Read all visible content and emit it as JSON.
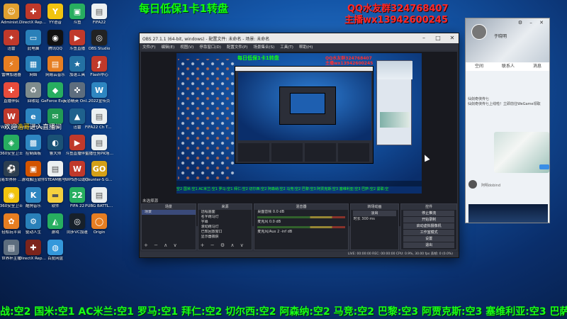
{
  "overlay": {
    "top_title": "每日低保1卡1转盘",
    "qq_group": "QQ水友群324768407",
    "host_wx": "主播wx13942600245",
    "welcome_prefix": "欢迎",
    "welcome_name": "浩哥",
    "welcome_suffix": "进入直播间",
    "ticker": "战:空2 国米:空1 AC米兰:空1 罗马:空1 拜仁:空2 切尔西:空2 阿森纳:空2 马竞:空2 巴黎:空3 阿贾克斯:空3 塞维利亚:空3 巴萨:空2 曼联:空2"
  },
  "desktop_icons": [
    {
      "label": "Administ...",
      "icon": "user-folder-icon",
      "color": "#e0a030",
      "glyph": "☺"
    },
    {
      "label": "DirectX Repair v4...",
      "icon": "directx-icon",
      "color": "#c0392b",
      "glyph": "✚"
    },
    {
      "label": "YY语音",
      "icon": "yy-icon",
      "color": "#f1c40f",
      "glyph": "Y"
    },
    {
      "label": "斗鱼",
      "icon": "app-icon",
      "color": "#27ae60",
      "glyph": "▣"
    },
    {
      "label": "FIFA22",
      "icon": "file-icon",
      "color": "#ecf0f1",
      "glyph": "▤"
    },
    {
      "label": "迅雷",
      "icon": "app-icon",
      "color": "#c0392b",
      "glyph": "✦"
    },
    {
      "label": "此电脑",
      "icon": "computer-icon",
      "color": "#2980b9",
      "glyph": "▭"
    },
    {
      "label": "腾讯QQ",
      "icon": "qq-icon",
      "color": "#111111",
      "glyph": "◉"
    },
    {
      "label": "斗鱼直播",
      "icon": "app-icon",
      "color": "#c0392b",
      "glyph": "▶"
    },
    {
      "label": "OBS Studio",
      "icon": "obs-icon",
      "color": "#222222",
      "glyph": "◎"
    },
    {
      "label": "雷神加速器",
      "icon": "app-icon",
      "color": "#e67e22",
      "glyph": "⚡"
    },
    {
      "label": "网络",
      "icon": "network-icon",
      "color": "#2980b9",
      "glyph": "▦"
    },
    {
      "label": "网易云音乐",
      "icon": "file-icon",
      "color": "#e67e22",
      "glyph": "▤"
    },
    {
      "label": "加速工具",
      "icon": "app-icon",
      "color": "#2471a3",
      "glyph": "★"
    },
    {
      "label": "Flash中心",
      "icon": "flash-icon",
      "color": "#c0392b",
      "glyph": "ƒ"
    },
    {
      "label": "直播伴侣",
      "icon": "app-icon",
      "color": "#e74c3c",
      "glyph": "✚"
    },
    {
      "label": "回收站",
      "icon": "recycle-bin-icon",
      "color": "#7f8c8d",
      "glyph": "♻"
    },
    {
      "label": "GeForce Experience",
      "icon": "nvidia-icon",
      "color": "#27ae60",
      "glyph": "◆"
    },
    {
      "label": "反恐精英 Online",
      "icon": "game-icon",
      "color": "#5d6d7e",
      "glyph": "✜"
    },
    {
      "label": "2022宣传页",
      "icon": "word-icon",
      "color": "#2e86c1",
      "glyph": "W"
    },
    {
      "label": "WPS Office",
      "icon": "wps-icon",
      "color": "#c0392b",
      "glyph": "W"
    },
    {
      "label": "Internet Explorer",
      "icon": "ie-icon",
      "color": "#2e86c1",
      "glyph": "e"
    },
    {
      "label": "微信",
      "icon": "app-icon",
      "color": "#229954",
      "glyph": "✉"
    },
    {
      "label": "迅雷",
      "icon": "app-icon",
      "color": "#1f618d",
      "glyph": "▲"
    },
    {
      "label": "FIFA22 Ch Tabel(F...",
      "icon": "file-icon",
      "color": "#ecf0f1",
      "glyph": "▤"
    },
    {
      "label": "360安全卫士",
      "icon": "shield-icon",
      "color": "#27ae60",
      "glyph": "◈"
    },
    {
      "label": "控制面板",
      "icon": "control-panel-icon",
      "color": "#2e86c1",
      "glyph": "▩"
    },
    {
      "label": "鲁大师",
      "icon": "app-icon",
      "color": "#1a5276",
      "glyph": "◐"
    },
    {
      "label": "斗鱼直播伴侣",
      "icon": "app-icon",
      "color": "#c0392b",
      "glyph": "▶"
    },
    {
      "label": "主播任务PK场排行榜...",
      "icon": "file-icon",
      "color": "#ecf0f1",
      "glyph": "▤"
    },
    {
      "label": "网易世界杯 平台",
      "icon": "app-icon",
      "color": "#2c3e50",
      "glyph": "⚽"
    },
    {
      "label": "游戏解压软件",
      "icon": "app-icon",
      "color": "#d35400",
      "glyph": "▣"
    },
    {
      "label": "STEAM账号",
      "icon": "file-icon",
      "color": "#ecf0f1",
      "glyph": "▤"
    },
    {
      "label": "WPS办公助手",
      "icon": "wps-icon",
      "color": "#c0392b",
      "glyph": "W"
    },
    {
      "label": "Counter-S Global Off...",
      "icon": "csgo-icon",
      "color": "#d4a017",
      "glyph": "GO"
    },
    {
      "label": "360安全卫士",
      "icon": "app-icon",
      "color": "#f1c40f",
      "glyph": "◉"
    },
    {
      "label": "酷狗音乐",
      "icon": "app-icon",
      "color": "#2e86c1",
      "glyph": "K"
    },
    {
      "label": "软件",
      "icon": "folder-icon",
      "color": "#f4d03f",
      "glyph": "▬"
    },
    {
      "label": "FIFA 22",
      "icon": "fifa-icon",
      "color": "#27ae60",
      "glyph": "22"
    },
    {
      "label": "PUBG BATTLEGR...",
      "icon": "file-icon",
      "color": "#ecf0f1",
      "glyph": "▤"
    },
    {
      "label": "轻松玩平台",
      "icon": "app-icon",
      "color": "#e67e22",
      "glyph": "✿"
    },
    {
      "label": "驱动人生",
      "icon": "gear-icon",
      "color": "#2980b9",
      "glyph": "⚙"
    },
    {
      "label": "游戏",
      "icon": "app-icon",
      "color": "#27ae60",
      "glyph": "◭"
    },
    {
      "label": "同步VC加速",
      "icon": "app-icon",
      "color": "#17202a",
      "glyph": "◎"
    },
    {
      "label": "Origin",
      "icon": "origin-icon",
      "color": "#e67e22",
      "glyph": "◯"
    },
    {
      "label": "世界杯主播",
      "icon": "file-icon",
      "color": "#5d6d7e",
      "glyph": "▤"
    },
    {
      "label": "DirectX Repair v4...",
      "icon": "directx-icon",
      "color": "#7b241c",
      "glyph": "✚"
    },
    {
      "label": "百度网盘",
      "icon": "app-icon",
      "color": "#3498db",
      "glyph": "◍"
    }
  ],
  "obs": {
    "title": "OBS 27.1.1 (64-bit, windows) - 配置文件: 未命名 - 场景: 未命名",
    "menu": [
      "文件(F)",
      "编辑(E)",
      "视图(V)",
      "停靠窗口(D)",
      "配置文件(P)",
      "场景集合(S)",
      "工具(T)",
      "帮助(H)"
    ],
    "canvas_title": "每日低保1卡1转盘",
    "canvas_qq": "QQ水友群324768407",
    "canvas_wx": "主播wx13942600245",
    "canvas_ticker": "空2 国米:空1 AC米兰:空1 罗马:空1 拜仁:空2 切尔西:空2 阿森纳:空2 马竞:空2 巴黎:空3 阿贾克斯:空3 塞维利亚:空3 巴萨:空2 曼联:空",
    "no_source": "未选择源",
    "scenes": {
      "header": "场景",
      "items": [
        "场景"
      ]
    },
    "sources": {
      "header": "来源",
      "items": [
        "远程画面",
        "名字跑马灯",
        "字幕",
        "滚动跑马灯",
        "已知回放窗口",
        "显示器捕获"
      ]
    },
    "mixer": {
      "header": "混音器",
      "items": [
        "桌面音频 0.0 dB",
        "麦克风 0.0 dB",
        "麦克风/Aux 2 -inf dB"
      ]
    },
    "transitions": {
      "header": "转场动画",
      "type": "淡出",
      "duration_label": "时长",
      "duration": "300 ms"
    },
    "controls": {
      "header": "控件",
      "buttons": [
        "停止推流",
        "开始录制",
        "启动虚拟摄像机",
        "工作室模式",
        "设置",
        "退出"
      ]
    },
    "status": "LIVE: 00:00:00   REC: 00:00:00   CPU: 0.9%, 30.00 fps   丢帧: 0 (0.0%)"
  },
  "side_panel": {
    "nickname": "于晓明",
    "tabs": [
      "空间",
      "联系人",
      "消息"
    ],
    "feed_line1": "仙剑奇侠传七",
    "feed_line2": "仙剑奇侠传七上线啦！立即前往WeGame领取",
    "person_name": "阿明dobind"
  }
}
